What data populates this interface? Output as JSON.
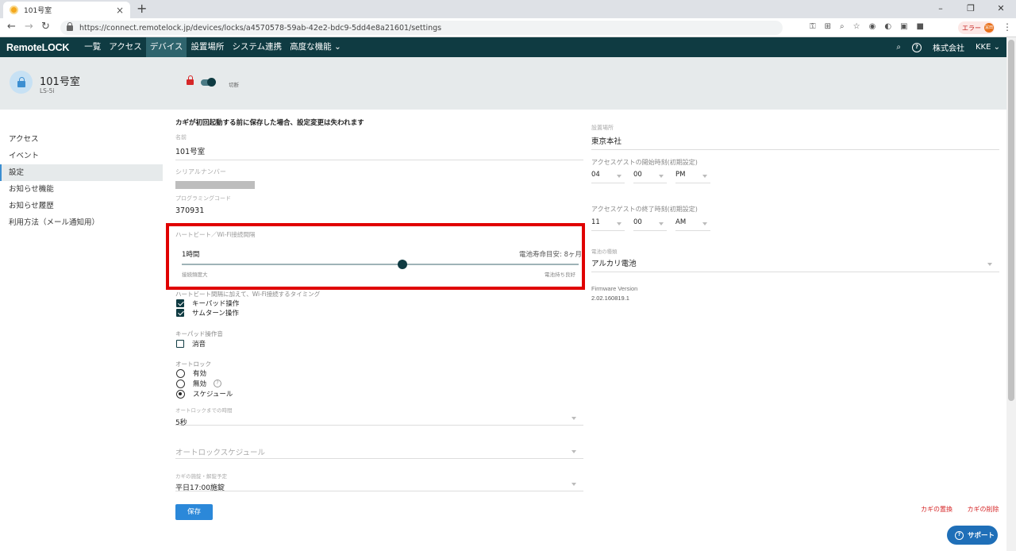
{
  "browser": {
    "tab_title": "101号室",
    "url": "https://connect.remotelock.jp/devices/locks/a4570578-59ab-42e2-bdc9-5dd4e8a21601/settings",
    "error_label": "エラー",
    "avatar_text": "冨田"
  },
  "app": {
    "logo": "RemoteLOCK",
    "nav": [
      "一覧",
      "アクセス",
      "デバイス",
      "設置場所",
      "システム連携",
      "高度な機能 ⌄"
    ],
    "active_nav": "デバイス",
    "company": "株式会社",
    "user": "KKE ⌄"
  },
  "device": {
    "name": "101号室",
    "model": "LS-5i",
    "toggle_label": "切断"
  },
  "sidebar": {
    "items": [
      "アクセス",
      "イベント",
      "設定",
      "お知らせ機能",
      "お知らせ履歴",
      "利用方法（メール通知用）"
    ],
    "active": "設定"
  },
  "form": {
    "warning": "カギが初回起動する前に保存した場合、設定変更は失われます",
    "name_label": "名前",
    "name_value": "101号室",
    "serial_label": "シリアルナンバー",
    "prog_code_label": "プログラミングコード",
    "prog_code_value": "370931",
    "heartbeat": {
      "title": "ハートビート／Wi-Fi接続間隔",
      "value_label": "1時間",
      "battery_label": "電池寿命目安: 8ヶ月",
      "slider_min_label": "接続頻度大",
      "slider_max_label": "電池持ち良好",
      "slider_position": 0.555
    },
    "wifi_timing_label": "ハートビート間隔に加えて、Wi-Fi接続するタイミング",
    "wifi_timing_options": [
      {
        "label": "キーパッド操作",
        "checked": true
      },
      {
        "label": "サムターン操作",
        "checked": true
      }
    ],
    "keypad_sound_label": "キーパッド操作音",
    "mute_label": "消音",
    "mute_checked": false,
    "autolock_label": "オートロック",
    "autolock_options": [
      "有効",
      "無効",
      "スケジュール"
    ],
    "autolock_selected": "スケジュール",
    "autolock_time_label": "オートロックまでの時間",
    "autolock_time_value": "5秒",
    "autolock_schedule_placeholder": "オートロックスケジュール",
    "lock_schedule_label": "カギの施錠・解錠予定",
    "lock_schedule_value": "平日17:00施錠",
    "save_label": "保存"
  },
  "right": {
    "location_label": "設置場所",
    "location_value": "東京本社",
    "guest_start_label": "アクセスゲストの開始時刻(初期設定)",
    "guest_start": {
      "hour": "04",
      "minute": "00",
      "ampm": "PM"
    },
    "guest_end_label": "アクセスゲストの終了時刻(初期設定)",
    "guest_end": {
      "hour": "11",
      "minute": "00",
      "ampm": "AM"
    },
    "battery_type_label": "電池の種類",
    "battery_type_value": "アルカリ電池",
    "firmware_label": "Firmware Version",
    "firmware_value": "2.02.160819.1",
    "replace_label": "カギの置換",
    "delete_label": "カギの削除",
    "support_label": "サポート"
  }
}
